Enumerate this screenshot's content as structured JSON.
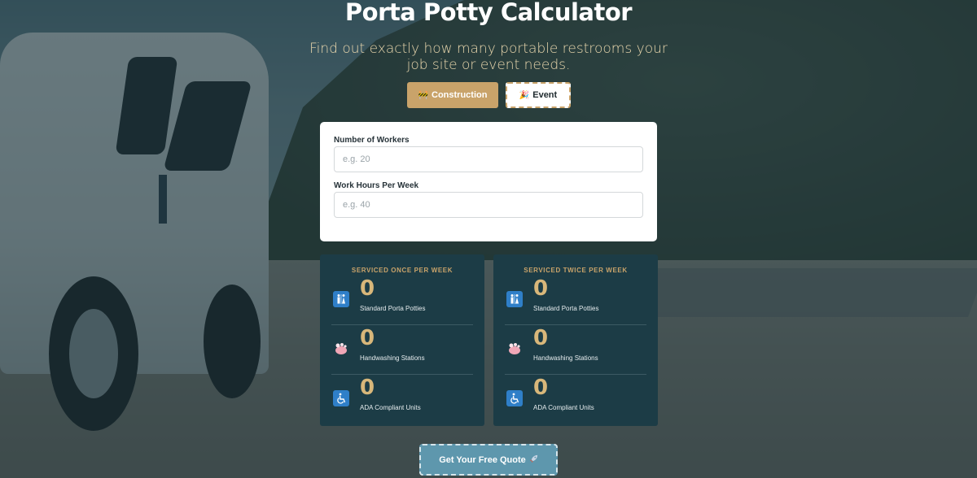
{
  "header": {
    "title": "Porta Potty Calculator",
    "subtitle": "Find out exactly how many portable restrooms your job site or event needs."
  },
  "modes": [
    {
      "label": "Construction",
      "icon": "construction-icon",
      "emoji": "🚧",
      "selected": true
    },
    {
      "label": "Event",
      "icon": "party-icon",
      "emoji": "🎉",
      "selected": false
    }
  ],
  "form": {
    "fields": [
      {
        "label": "Number of Workers",
        "placeholder": "e.g. 20",
        "value": ""
      },
      {
        "label": "Work Hours Per Week",
        "placeholder": "e.g. 40",
        "value": ""
      }
    ]
  },
  "results": [
    {
      "header": "SERVICED ONCE PER WEEK",
      "rows": [
        {
          "value": "0",
          "label": "Standard Porta Potties",
          "icon": "restroom-icon"
        },
        {
          "value": "0",
          "label": "Handwashing Stations",
          "icon": "soap-icon"
        },
        {
          "value": "0",
          "label": "ADA Compliant Units",
          "icon": "wheelchair-icon"
        }
      ]
    },
    {
      "header": "SERVICED TWICE PER WEEK",
      "rows": [
        {
          "value": "0",
          "label": "Standard Porta Potties",
          "icon": "restroom-icon"
        },
        {
          "value": "0",
          "label": "Handwashing Stations",
          "icon": "soap-icon"
        },
        {
          "value": "0",
          "label": "ADA Compliant Units",
          "icon": "wheelchair-icon"
        }
      ]
    }
  ],
  "cta": {
    "label": "Get Your Free Quote",
    "icon": "rocket-icon"
  },
  "colors": {
    "accent_gold": "#c9a36a",
    "card_dark": "#1c3c46",
    "cta_blue": "#5e97ad",
    "icon_blue": "#2f7fc8"
  }
}
